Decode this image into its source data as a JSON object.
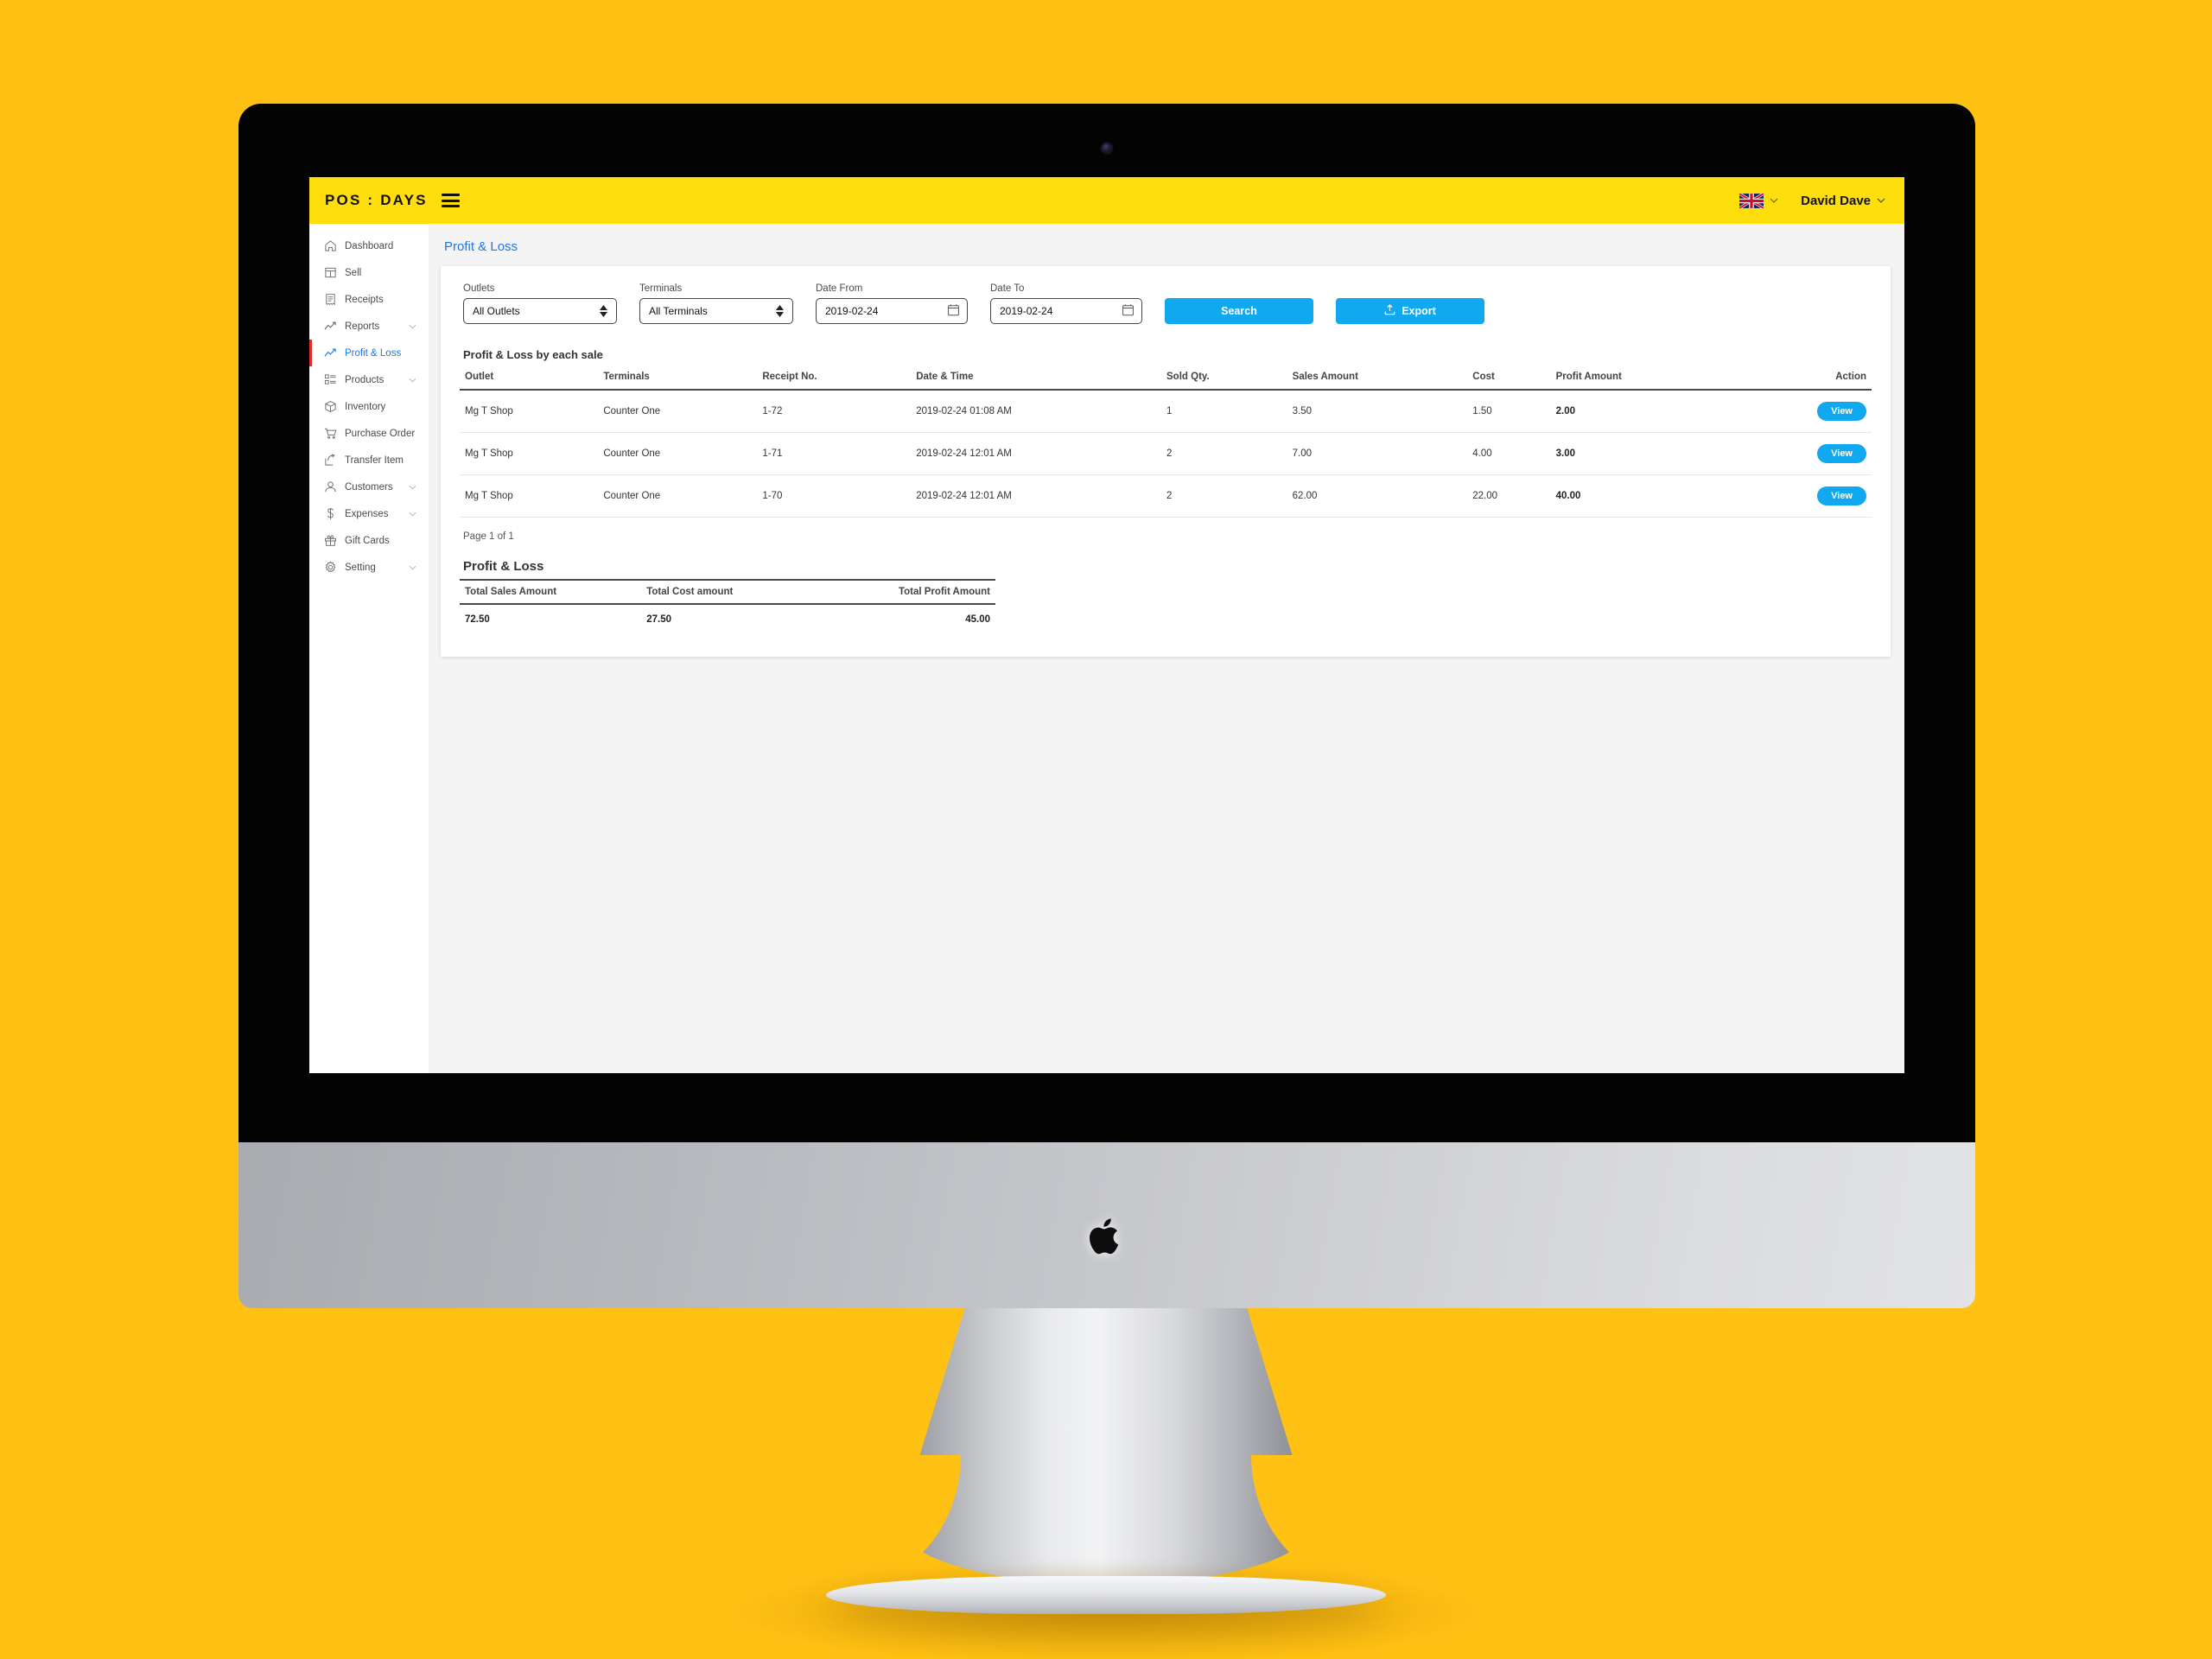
{
  "navbar": {
    "brand": "POS : DAYS",
    "menu_icon": "hamburger-icon",
    "language_flag": "uk-flag-icon",
    "user_name": "David Dave"
  },
  "sidebar": {
    "items": [
      {
        "label": "Dashboard",
        "icon": "home-icon",
        "expandable": false,
        "active": false
      },
      {
        "label": "Sell",
        "icon": "layout-icon",
        "expandable": false,
        "active": false
      },
      {
        "label": "Receipts",
        "icon": "receipt-icon",
        "expandable": false,
        "active": false
      },
      {
        "label": "Reports",
        "icon": "trend-up-icon",
        "expandable": true,
        "active": false
      },
      {
        "label": "Profit & Loss",
        "icon": "trend-up-icon",
        "expandable": false,
        "active": true
      },
      {
        "label": "Products",
        "icon": "list-grid-icon",
        "expandable": true,
        "active": false
      },
      {
        "label": "Inventory",
        "icon": "box-icon",
        "expandable": false,
        "active": false
      },
      {
        "label": "Purchase Order",
        "icon": "shopping-cart-icon",
        "expandable": false,
        "active": false
      },
      {
        "label": "Transfer Item",
        "icon": "share-arrow-icon",
        "expandable": false,
        "active": false
      },
      {
        "label": "Customers",
        "icon": "user-icon",
        "expandable": true,
        "active": false
      },
      {
        "label": "Expenses",
        "icon": "dollar-icon",
        "expandable": true,
        "active": false
      },
      {
        "label": "Gift Cards",
        "icon": "gift-icon",
        "expandable": false,
        "active": false
      },
      {
        "label": "Setting",
        "icon": "gear-icon",
        "expandable": true,
        "active": false
      }
    ]
  },
  "page": {
    "title": "Profit & Loss"
  },
  "filters": {
    "outlets_label": "Outlets",
    "outlets_value": "All Outlets",
    "terminals_label": "Terminals",
    "terminals_value": "All Terminals",
    "date_from_label": "Date From",
    "date_from_value": "2019-02-24",
    "date_to_label": "Date To",
    "date_to_value": "2019-02-24",
    "search_label": "Search",
    "export_label": "Export",
    "export_icon": "upload-icon"
  },
  "sales_section": {
    "title": "Profit & Loss by each sale",
    "columns": [
      "Outlet",
      "Terminals",
      "Receipt No.",
      "Date & Time",
      "Sold Qty.",
      "Sales Amount",
      "Cost",
      "Profit Amount",
      "Action"
    ],
    "rows": [
      {
        "outlet": "Mg T Shop",
        "terminal": "Counter One",
        "receipt_no": "1-72",
        "datetime": "2019-02-24 01:08 AM",
        "sold_qty": "1",
        "sales_amount": "3.50",
        "cost": "1.50",
        "profit_amount": "2.00",
        "action_label": "View"
      },
      {
        "outlet": "Mg T Shop",
        "terminal": "Counter One",
        "receipt_no": "1-71",
        "datetime": "2019-02-24 12:01 AM",
        "sold_qty": "2",
        "sales_amount": "7.00",
        "cost": "4.00",
        "profit_amount": "3.00",
        "action_label": "View"
      },
      {
        "outlet": "Mg T Shop",
        "terminal": "Counter One",
        "receipt_no": "1-70",
        "datetime": "2019-02-24 12:01 AM",
        "sold_qty": "2",
        "sales_amount": "62.00",
        "cost": "22.00",
        "profit_amount": "40.00",
        "action_label": "View"
      }
    ],
    "pagination": "Page 1 of 1"
  },
  "summary_section": {
    "title": "Profit & Loss",
    "columns": [
      "Total Sales Amount",
      "Total Cost amount",
      "Total Profit Amount"
    ],
    "values": [
      "72.50",
      "27.50",
      "45.00"
    ]
  },
  "colors": {
    "background_yellow": "#FFC113",
    "navbar_yellow": "#FFDE0D",
    "accent_blue": "#10A8EF",
    "link_blue": "#1877F2",
    "active_red": "#E62B2B"
  }
}
